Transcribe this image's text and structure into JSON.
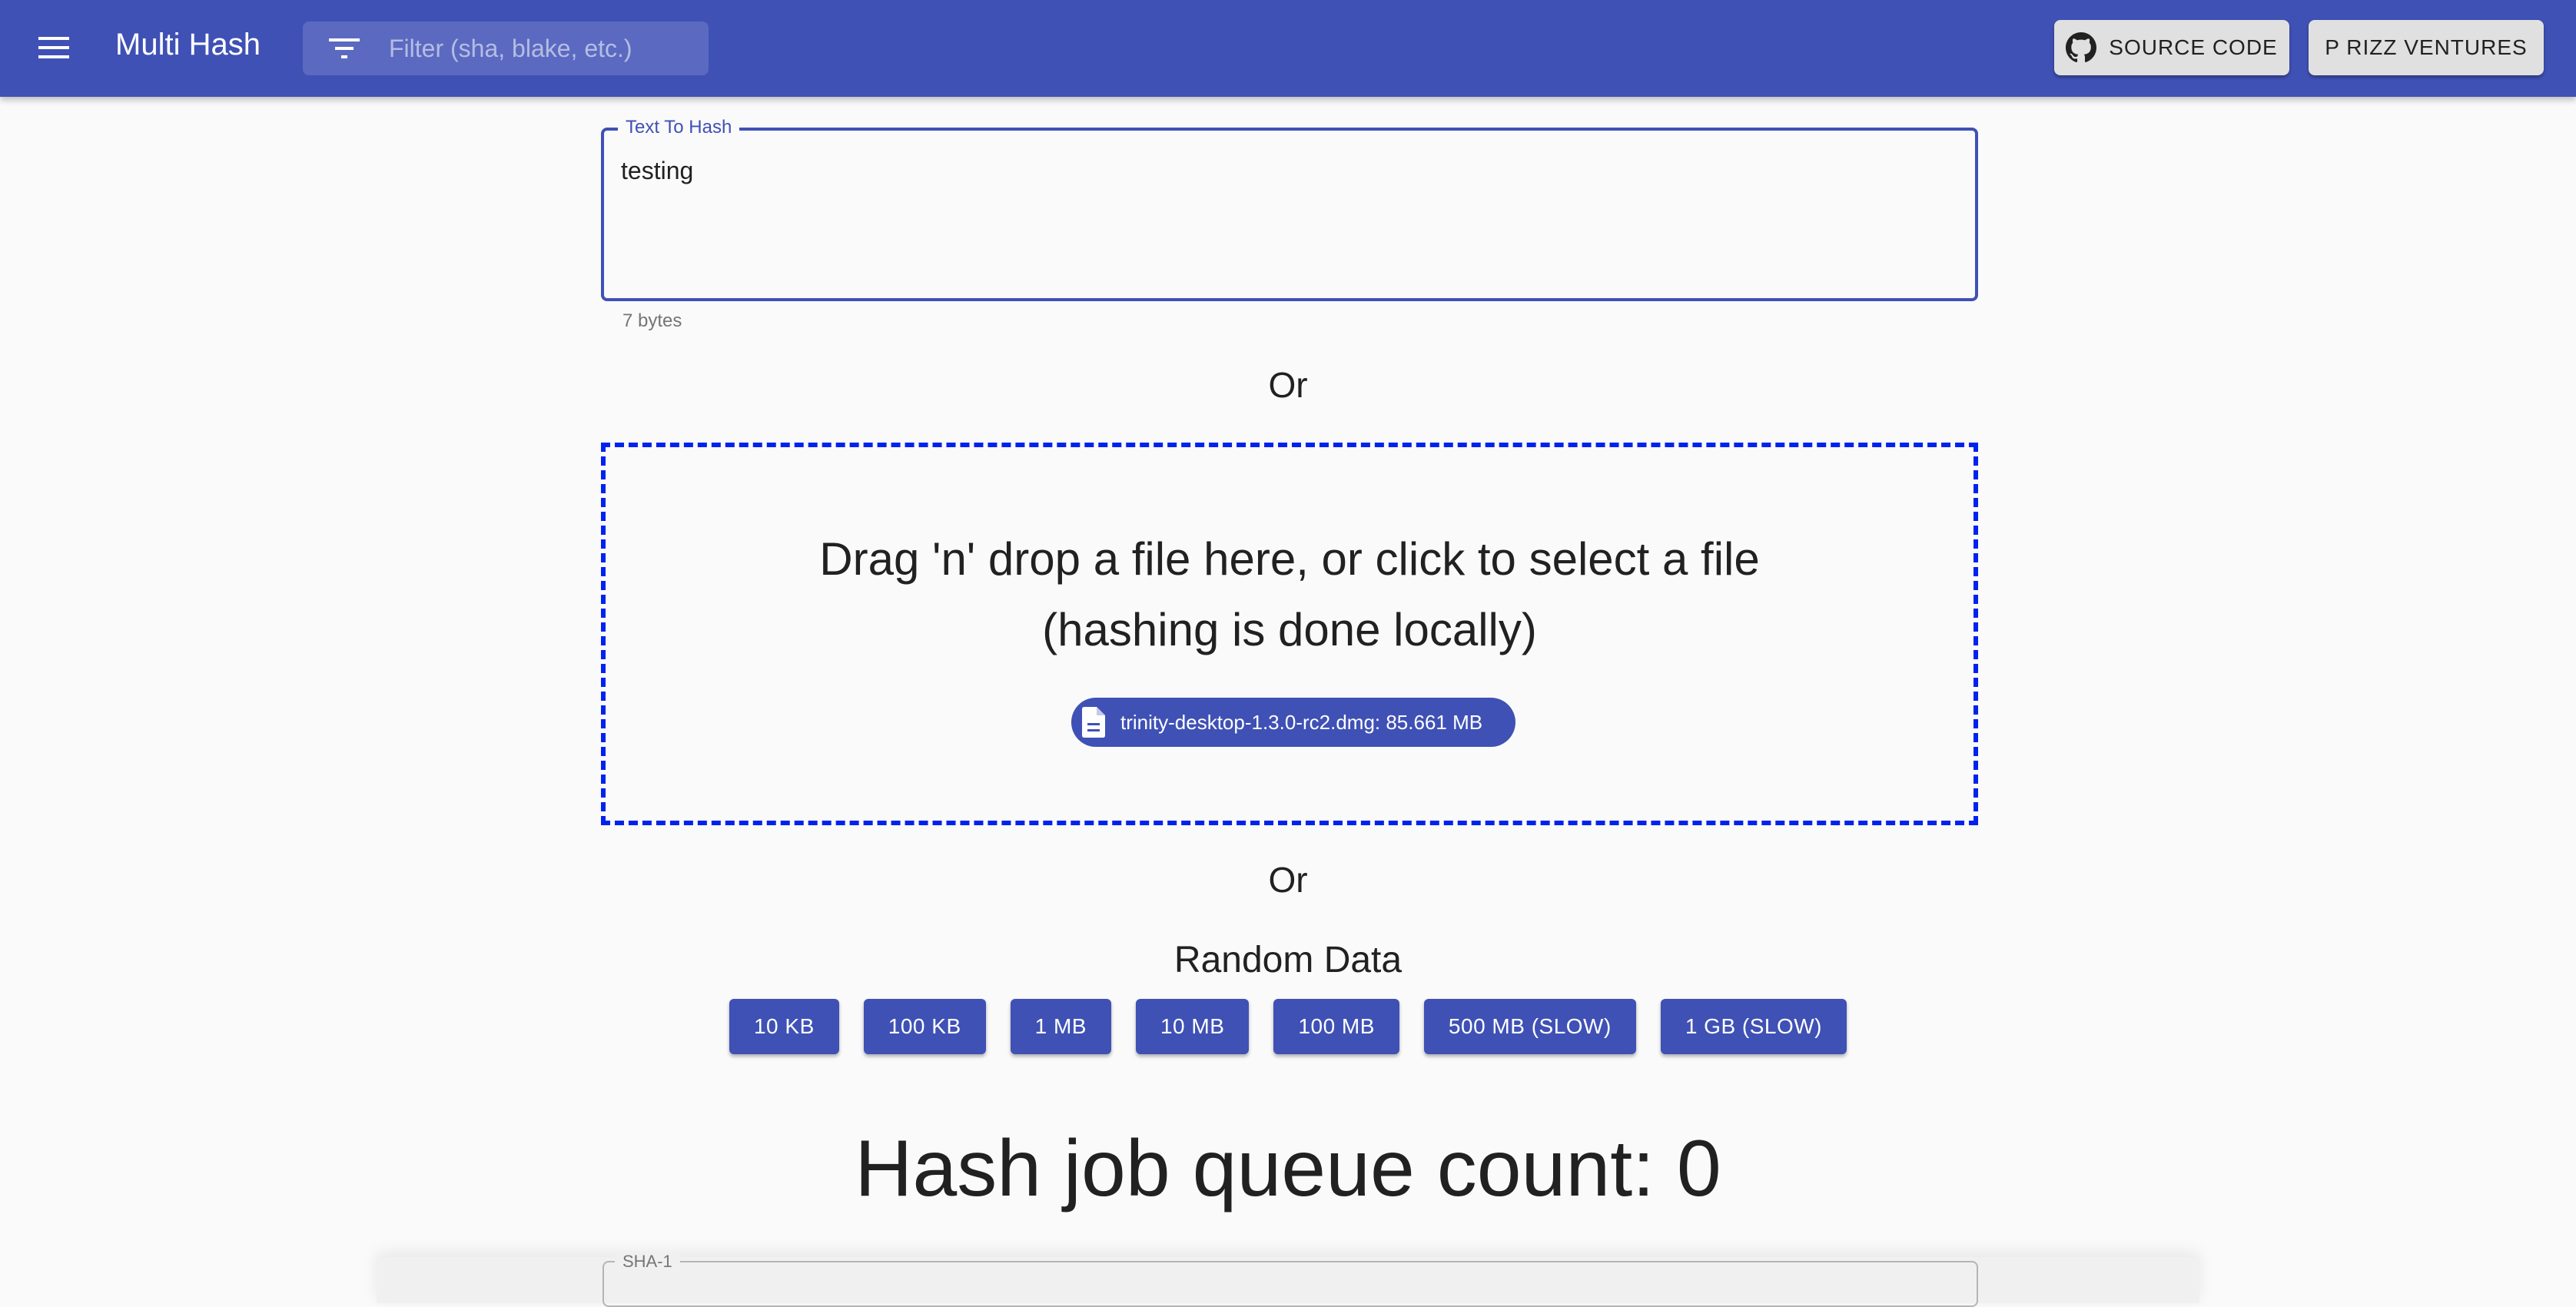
{
  "appbar": {
    "menu_icon": "menu-icon",
    "title": "Multi Hash",
    "filter": {
      "icon": "filter-list-icon",
      "placeholder": "Filter (sha, blake, etc.)",
      "value": ""
    },
    "buttons": [
      {
        "label": "SOURCE CODE",
        "icon": "github-icon"
      },
      {
        "label": "P RIZZ VENTURES"
      }
    ]
  },
  "text_input": {
    "label": "Text To Hash",
    "value": "testing",
    "helper": "7 bytes"
  },
  "separators": {
    "or1": "Or",
    "or2": "Or"
  },
  "dropzone": {
    "line1": "Drag 'n' drop a file here, or click to select a file",
    "line2": "(hashing is done locally)",
    "file_chip": {
      "icon": "file-icon",
      "label": "trinity-desktop-1.3.0-rc2.dmg: 85.661 MB"
    },
    "border_color": "#0022ee"
  },
  "random_data": {
    "title": "Random Data",
    "buttons": [
      "10 KB",
      "100 KB",
      "1 MB",
      "10 MB",
      "100 MB",
      "500 MB (SLOW)",
      "1 GB (SLOW)"
    ]
  },
  "queue": {
    "text": "Hash job queue count: 0"
  },
  "results": [
    {
      "label": "SHA-1",
      "value": ""
    }
  ],
  "colors": {
    "primary": "#3f51b5",
    "background": "#fafafa",
    "secondary_button": "#e0e0e0"
  }
}
